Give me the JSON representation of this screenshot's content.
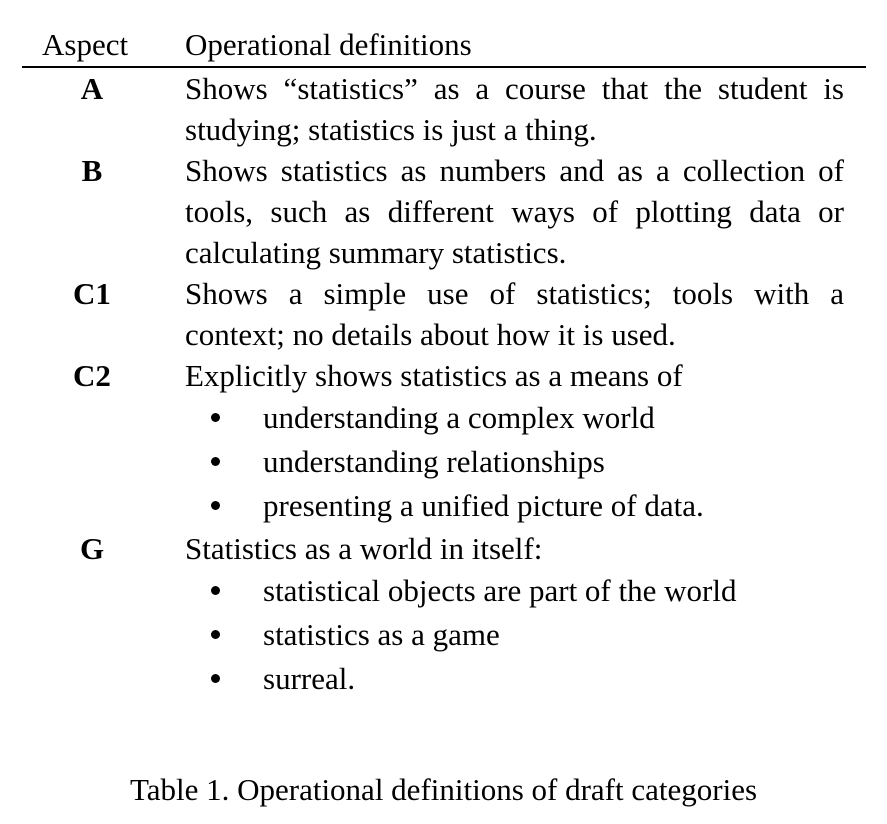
{
  "table": {
    "header": {
      "aspect": "Aspect",
      "definitions": "Operational definitions"
    },
    "rows": [
      {
        "aspect": "A",
        "text": "Shows “statistics” as a course that the student is studying; statistics is just a thing.",
        "bullets": []
      },
      {
        "aspect": "B",
        "text": "Shows statistics as numbers and as a collection of tools, such as different ways of plotting data or calculating summary statistics.",
        "bullets": []
      },
      {
        "aspect": "C1",
        "text": "Shows a simple use of statistics; tools with a context; no details about how it is used.",
        "bullets": []
      },
      {
        "aspect": "C2",
        "text": "Explicitly shows statistics as a means of",
        "bullets": [
          "understanding a complex world",
          "understanding relationships",
          "presenting a unified picture of data."
        ]
      },
      {
        "aspect": "G",
        "text": "Statistics as a world in itself:",
        "bullets": [
          "statistical objects are part of the world",
          "statistics as a game",
          "surreal."
        ]
      }
    ]
  },
  "caption": "Table 1. Operational definitions of draft categories"
}
